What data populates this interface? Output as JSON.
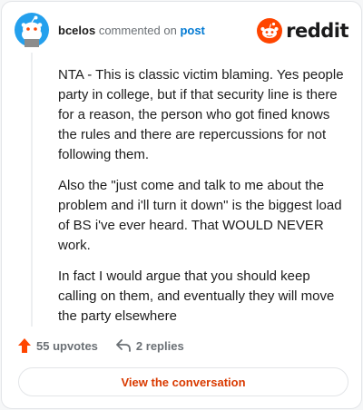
{
  "header": {
    "username": "bcelos",
    "action_text": "commented on",
    "post_link": "post",
    "avatar_icon": "snoo-avatar-icon",
    "brand_icon": "reddit-logo-icon",
    "brand_text": "reddit"
  },
  "comment": {
    "paragraphs": [
      "NTA - This is classic victim blaming. Yes people party in college, but if that security line is there for a reason, the person who got fined knows the rules and there are repercussions for not following them.",
      "Also the \"just come and talk to me about the problem and i'll turn it down\" is the biggest load of BS i've ever heard. That WOULD NEVER work.",
      "In fact I would argue that you should keep calling on them, and eventually they will move the party elsewhere"
    ]
  },
  "footer": {
    "upvotes": "55 upvotes",
    "replies": "2 replies",
    "upvote_icon": "upvote-arrow-icon",
    "reply_icon": "reply-arrow-icon"
  },
  "cta": {
    "label": "View the conversation"
  },
  "colors": {
    "brand": "#ff4500",
    "link": "#0079d3",
    "cta": "#d93a00",
    "avatar_bg": "#24a0ed"
  }
}
